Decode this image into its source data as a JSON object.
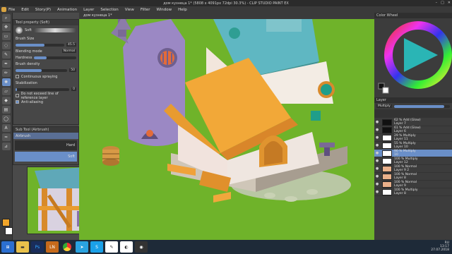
{
  "window": {
    "title": "дом кузнеца 1* (5808 x 4091px 72dpi 30.3%) - CLIP STUDIO PAINT EX"
  },
  "menu": [
    "File",
    "Edit",
    "Story(P)",
    "Animation",
    "Layer",
    "Selection",
    "View",
    "Filter",
    "Window",
    "Help"
  ],
  "panel_tabs": {
    "tool_property": "Tool property (Soft)",
    "sub_tool": "Sub Tool (Airbrush)",
    "doc": "дом кузнеца 1*"
  },
  "tool_property": {
    "title": "Soft",
    "brush_size_label": "Brush Size",
    "brush_size": "45.5",
    "blending_mode_label": "Blending mode",
    "blending_mode": "Normal",
    "hardness_label": "Hardness",
    "brush_density_label": "Brush density",
    "brush_density": "50",
    "continuous_spraying": "Continuous spraying",
    "stabilization_label": "Stabilization",
    "stabilization": "0",
    "do_not_exceed": "Do not exceed line of reference layer",
    "anti_aliasing": "Anti-aliasing"
  },
  "sub_tools": {
    "group": "Airbrush",
    "items": [
      "Hard",
      "Soft"
    ]
  },
  "color_wheel": {
    "title": "Color Wheel"
  },
  "layers": {
    "title": "Layer",
    "blend": "Multiply",
    "items": [
      {
        "line1": "62 % Add (Glow)",
        "line2": "Layer 7"
      },
      {
        "line1": "61 % Add (Glow)",
        "line2": "Layer 6"
      },
      {
        "line1": "29 % Multiply",
        "line2": "Layer 11"
      },
      {
        "line1": "55 % Multiply",
        "line2": "Layer 10"
      },
      {
        "line1": "90 % Multiply",
        "line2": "10"
      },
      {
        "line1": "100 % Multiply",
        "line2": "Layer 12"
      },
      {
        "line1": "100 % Normal",
        "line2": "Layer 9 2"
      },
      {
        "line1": "100 % Normal",
        "line2": "Layer 8"
      },
      {
        "line1": "100 % Normal",
        "line2": "Layer 9"
      },
      {
        "line1": "100 % Multiply",
        "line2": "Layer 8"
      }
    ]
  },
  "taskbar": {
    "apps": [
      "e",
      "Ps",
      "LN",
      "chrome",
      "tg",
      "skype",
      "vk",
      "paint",
      "obs"
    ],
    "lang": "RU",
    "time": "13:17",
    "date": "27.07.2018"
  },
  "colors": {
    "canvas_bg": "#6fb32a",
    "accent": "#6a8fc8",
    "panel": "#474747"
  }
}
